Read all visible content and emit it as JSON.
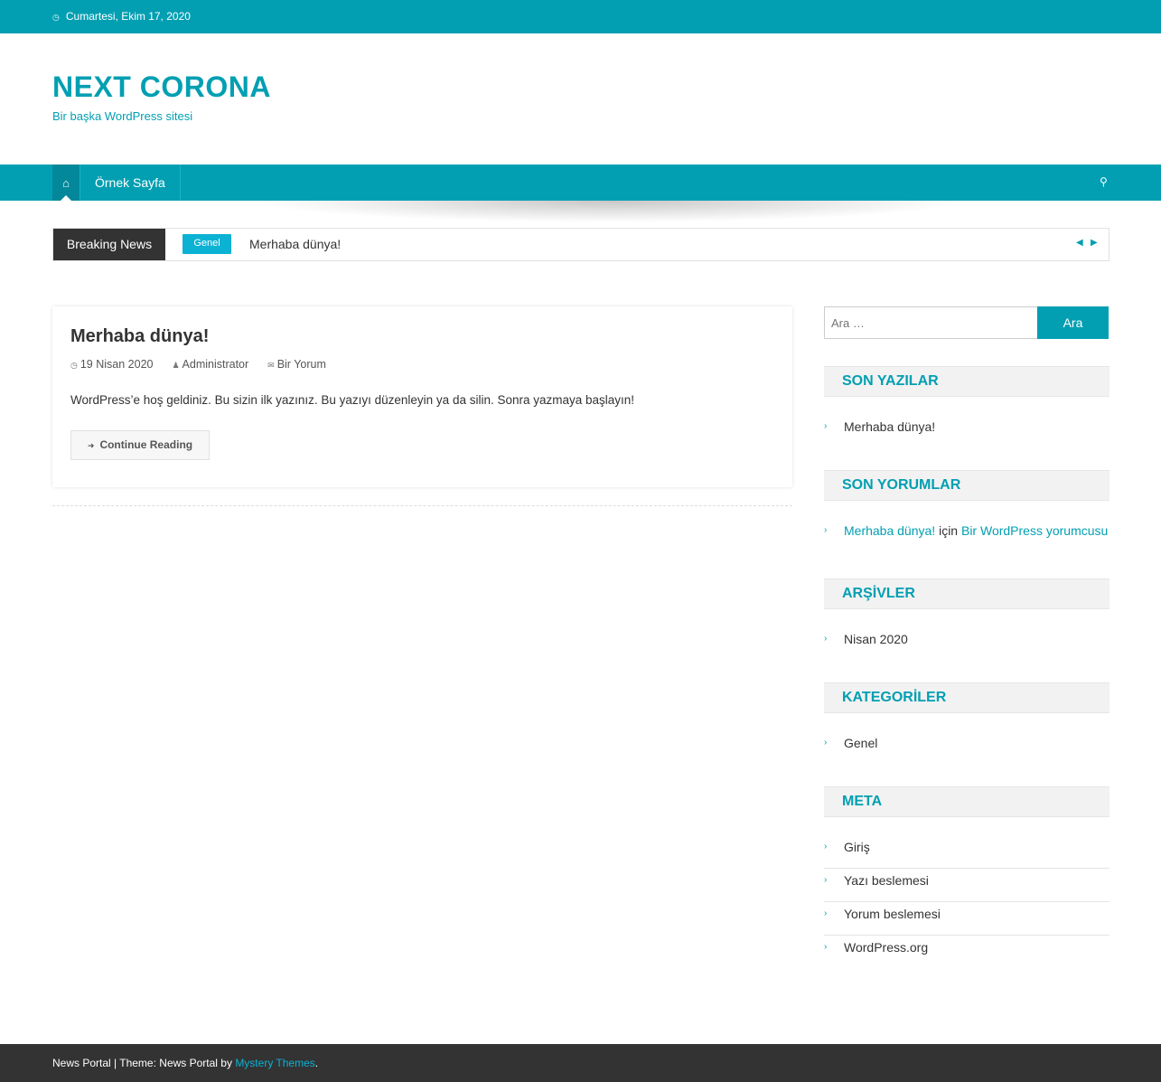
{
  "topbar": {
    "date": "Cumartesi, Ekim 17, 2020",
    "date_icon": "clock-icon"
  },
  "site": {
    "title": "NEXT CORONA",
    "tagline": "Bir başka WordPress sitesi"
  },
  "nav": {
    "home_icon": "home-icon",
    "items": [
      {
        "label": "Örnek Sayfa"
      }
    ],
    "search_icon": "search-icon"
  },
  "ticker": {
    "label": "Breaking News",
    "category": "Genel",
    "headline": "Merhaba dünya!",
    "prev_icon": "chevron-left-icon",
    "next_icon": "chevron-right-icon"
  },
  "post": {
    "title": "Merhaba dünya!",
    "date": "19 Nisan 2020",
    "author": "Administrator",
    "comments": "Bir Yorum",
    "excerpt": "WordPress’e hoş geldiniz. Bu sizin ilk yazınız. Bu yazıyı düzenleyin ya da silin. Sonra yazmaya başlayın!",
    "read_more": "Continue Reading"
  },
  "sidebar": {
    "search": {
      "placeholder": "Ara …",
      "button": "Ara"
    },
    "recent_posts": {
      "title": "SON YAZILAR",
      "items": [
        "Merhaba dünya!"
      ]
    },
    "recent_comments": {
      "title": "SON YORUMLAR",
      "items": [
        {
          "post": "Merhaba dünya!",
          "connector": "için",
          "author": "Bir WordPress yorumcusu"
        }
      ]
    },
    "archives": {
      "title": "ARŞİVLER",
      "items": [
        "Nisan 2020"
      ]
    },
    "categories": {
      "title": "KATEGORİLER",
      "items": [
        "Genel"
      ]
    },
    "meta": {
      "title": "META",
      "items": [
        "Giriş",
        "Yazı beslemesi",
        "Yorum beslemesi",
        "WordPress.org"
      ]
    }
  },
  "footer": {
    "prefix": "News Portal | Theme: News Portal by ",
    "link": "Mystery Themes",
    "suffix": "."
  },
  "colors": {
    "accent": "#029fb2",
    "dark": "#333333",
    "tag": "#0bb2d4"
  }
}
